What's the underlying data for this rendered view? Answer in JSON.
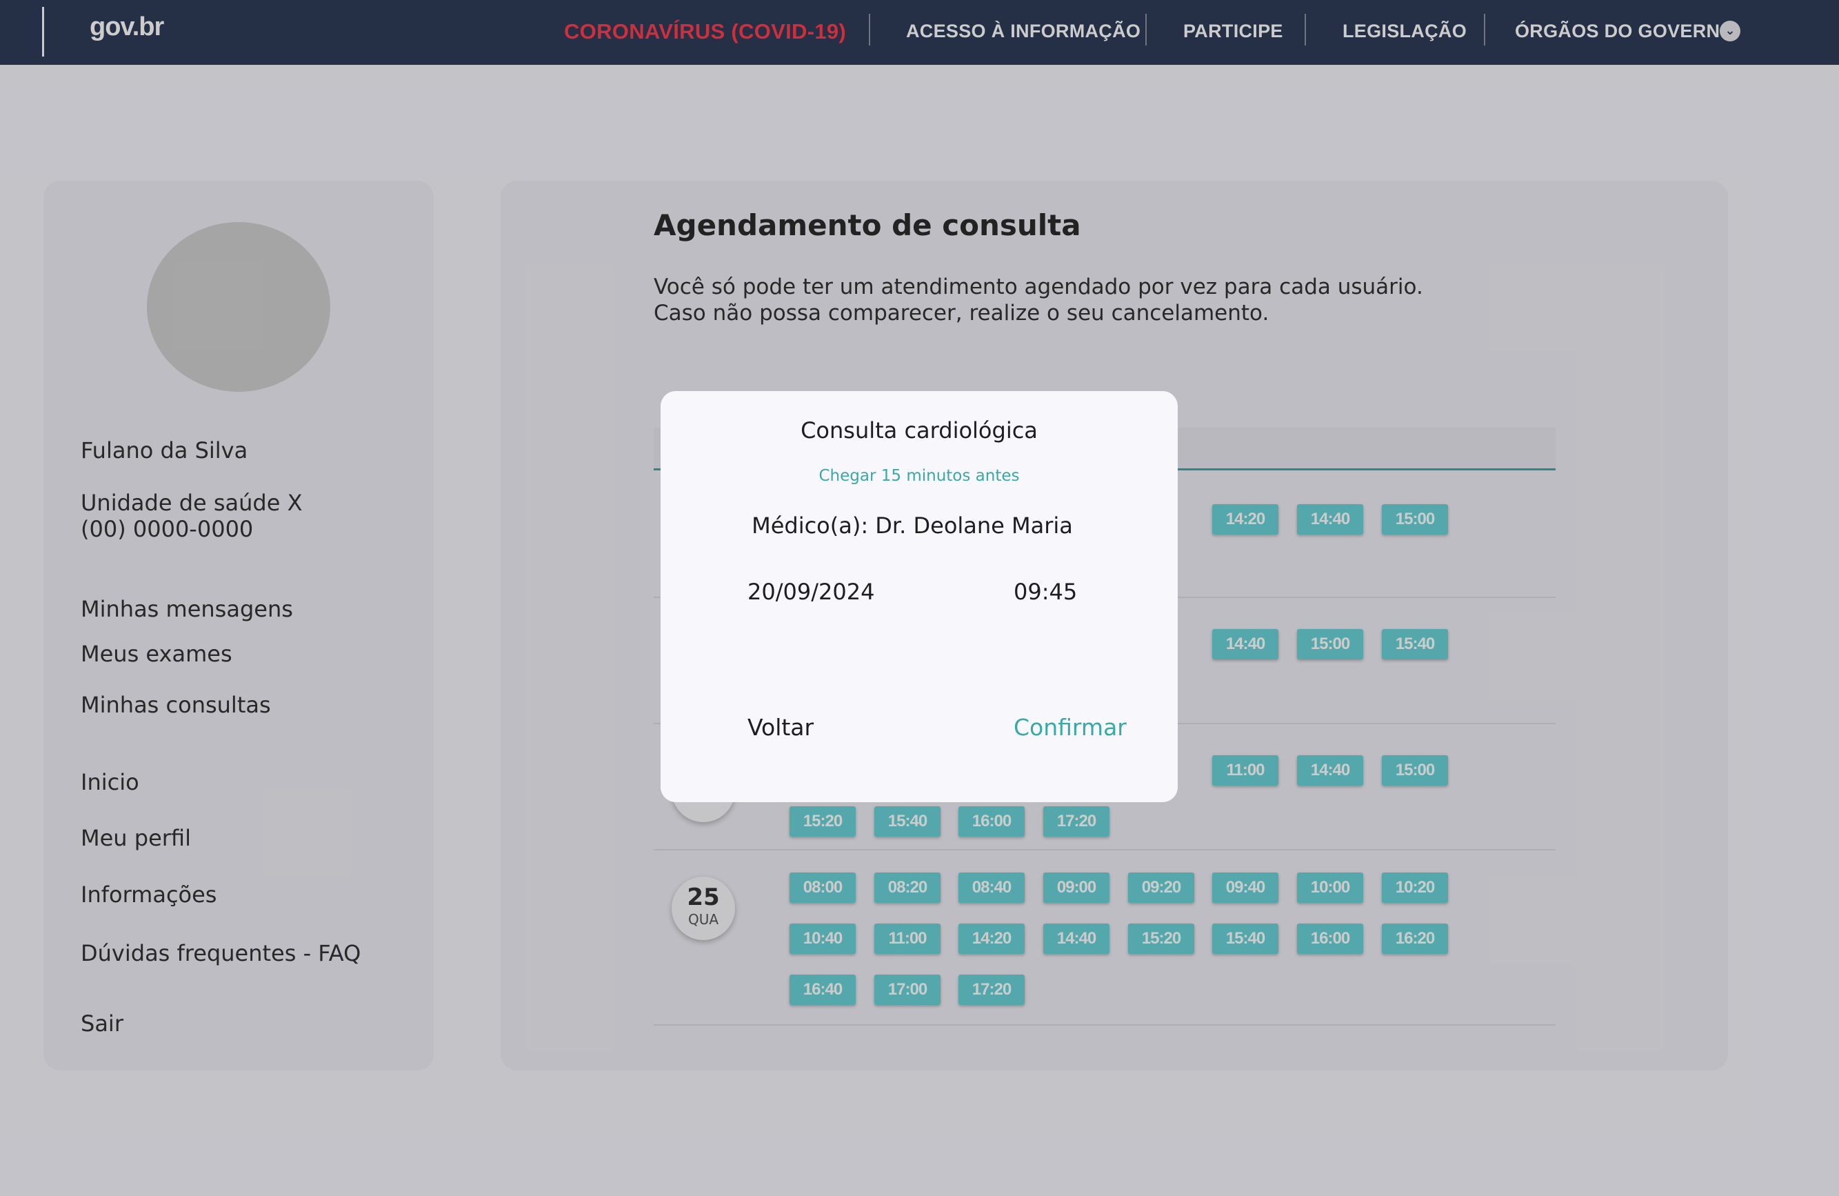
{
  "header": {
    "logo": "gov.br",
    "nav": [
      {
        "label": "CORONAVÍRUS (COVID-19)"
      },
      {
        "label": "ACESSO À INFORMAÇÃO"
      },
      {
        "label": "PARTICIPE"
      },
      {
        "label": "LEGISLAÇÃO"
      },
      {
        "label": "ÓRGÃOS DO GOVERNO"
      }
    ],
    "dropdown_icon": "chevron-down-icon"
  },
  "sidebar": {
    "user_name": "Fulano da Silva",
    "unit_name": "Unidade de saúde X",
    "unit_phone": "(00) 0000-0000",
    "menu": [
      {
        "label": "Minhas mensagens"
      },
      {
        "label": "Meus exames"
      },
      {
        "label": "Minhas consultas"
      },
      {
        "label": "Inicio"
      },
      {
        "label": "Meu perfil"
      },
      {
        "label": "Informações"
      },
      {
        "label": "Dúvidas frequentes - FAQ"
      },
      {
        "label": "Sair"
      }
    ]
  },
  "main": {
    "title": "Agendamento de consulta",
    "intro_line1": "Você só pode ter um atendimento agendado por vez para cada usuário.",
    "intro_line2": "Caso não possa comparecer, realize o seu cancelamento.",
    "days": [
      {
        "slots": [
          "14:20",
          "14:40",
          "15:00"
        ]
      },
      {
        "slots": [
          "14:40",
          "15:00",
          "15:40"
        ]
      },
      {
        "slots_row1": [
          "11:00",
          "14:40",
          "15:00"
        ],
        "slots_row2": [
          "15:20",
          "15:40",
          "16:00",
          "17:20"
        ]
      },
      {
        "day_number": "25",
        "weekday": "QUA",
        "slots_row1": [
          "08:00",
          "08:20",
          "08:40",
          "09:00",
          "09:20",
          "09:40",
          "10:00",
          "10:20"
        ],
        "slots_row2": [
          "10:40",
          "11:00",
          "14:20",
          "14:40",
          "15:20",
          "15:40",
          "16:00",
          "16:20"
        ],
        "slots_row3": [
          "16:40",
          "17:00",
          "17:20"
        ]
      }
    ]
  },
  "modal": {
    "title": "Consulta cardiológica",
    "note": "Chegar 15 minutos antes",
    "doctor": "Médico(a): Dr. Deolane Maria",
    "date": "20/09/2024",
    "time": "09:45",
    "back_label": "Voltar",
    "confirm_label": "Confirmar"
  },
  "colors": {
    "topbar": "#2f3b57",
    "covid_link": "#ff3b4d",
    "accent_teal": "#3aa8a8",
    "slot_bg": "#6ad3d6",
    "panel_bg": "#ededf4"
  }
}
